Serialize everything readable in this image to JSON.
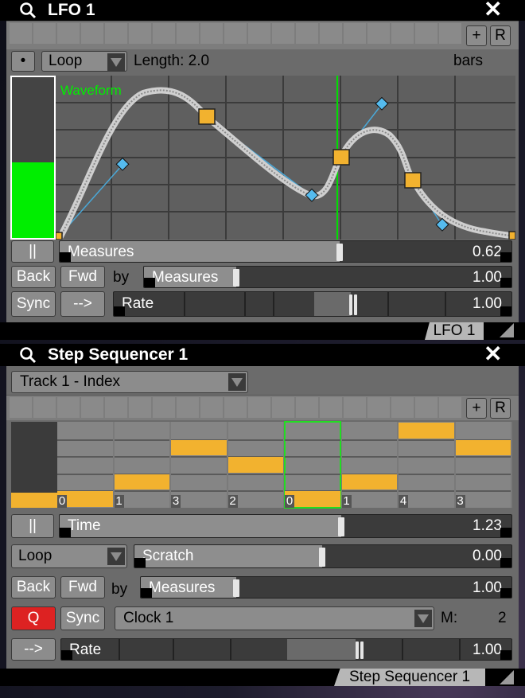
{
  "colors": {
    "accent_green": "#00ee00",
    "step_orange": "#f2b22f",
    "q_red": "#dd2222",
    "handle_blue": "#55bbee"
  },
  "lfo": {
    "title": "LFO 1",
    "plus_label": "+",
    "r_label": "R",
    "dot_label": "•",
    "mode": "Loop",
    "length_text": "Length: 2.0",
    "length_unit": "bars",
    "waveform_label": "Waveform",
    "level_fraction": 0.47,
    "pause_label": "||",
    "measures_label": "Measures",
    "measures_value": "0.62",
    "back_label": "Back",
    "fwd_label": "Fwd",
    "by_label": "by",
    "by_label2": "Measures",
    "by_value": "1.00",
    "sync_label": "Sync",
    "arrow_label": "-->",
    "rate_label": "Rate",
    "rate_value": "1.00",
    "tab_label": "LFO 1"
  },
  "seq": {
    "title": "Step Sequencer 1",
    "track": "Track 1 - Index",
    "plus_label": "+",
    "r_label": "R",
    "steps": [
      0,
      1,
      3,
      2,
      0,
      1,
      4,
      3
    ],
    "step_labels": [
      "0",
      "1",
      "3",
      "2",
      "0",
      "1",
      "4",
      "3"
    ],
    "current_step": 4,
    "pause_label": "||",
    "time_label": "Time",
    "time_value": "1.23",
    "mode": "Loop",
    "scratch_label": "Scratch",
    "scratch_value": "0.00",
    "back_label": "Back",
    "fwd_label": "Fwd",
    "by_label": "by",
    "by_label2": "Measures",
    "by_value": "1.00",
    "q_label": "Q",
    "sync_label": "Sync",
    "clock": "Clock 1",
    "m_label": "M:",
    "m_value": "2",
    "arrow_label": "-->",
    "rate_label": "Rate",
    "rate_value": "1.00",
    "tab_label": "Step Sequencer 1"
  }
}
